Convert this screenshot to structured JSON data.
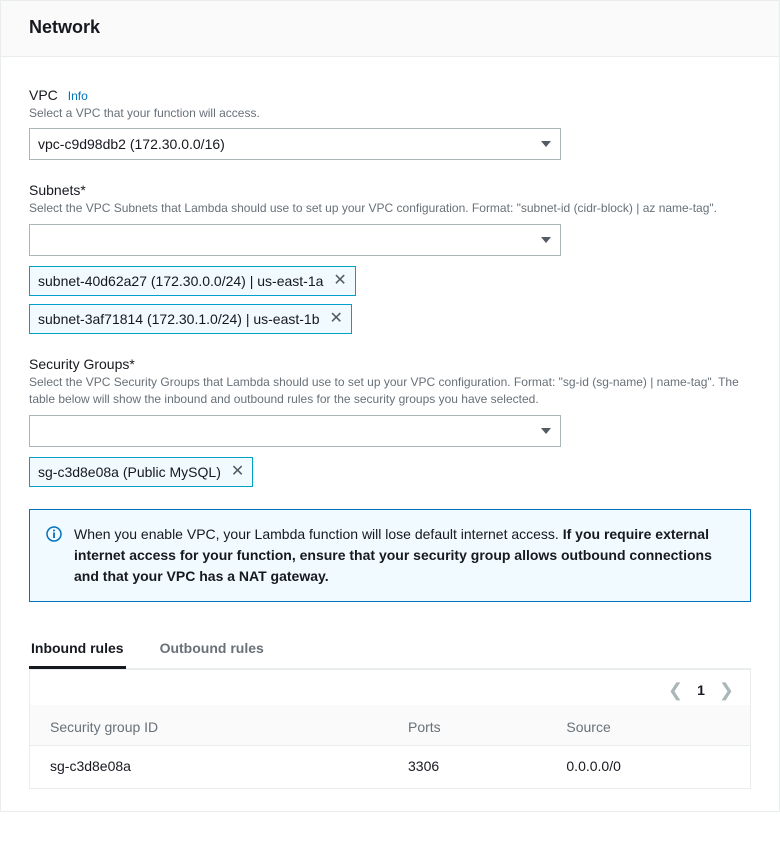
{
  "header": {
    "title": "Network"
  },
  "vpc": {
    "label": "VPC",
    "info_link": "Info",
    "description": "Select a VPC that your function will access.",
    "selected": "vpc-c9d98db2 (172.30.0.0/16)"
  },
  "subnets": {
    "label": "Subnets*",
    "description": "Select the VPC Subnets that Lambda should use to set up your VPC configuration. Format: \"subnet-id (cidr-block) | az name-tag\".",
    "selected": "",
    "tokens": [
      "subnet-40d62a27 (172.30.0.0/24) | us-east-1a",
      "subnet-3af71814 (172.30.1.0/24) | us-east-1b"
    ]
  },
  "security_groups": {
    "label": "Security Groups*",
    "description": "Select the VPC Security Groups that Lambda should use to set up your VPC configuration. Format: \"sg-id (sg-name) | name-tag\". The table below will show the inbound and outbound rules for the security groups you have selected.",
    "selected": "",
    "tokens": [
      "sg-c3d8e08a (Public MySQL)"
    ]
  },
  "alert": {
    "text_prefix": "When you enable VPC, your Lambda function will lose default internet access. ",
    "text_bold": "If you require external internet access for your function, ensure that your security group allows outbound connections and that your VPC has a NAT gateway."
  },
  "tabs": {
    "inbound": "Inbound rules",
    "outbound": "Outbound rules"
  },
  "pagination": {
    "page": "1"
  },
  "table": {
    "columns": {
      "sg": "Security group ID",
      "ports": "Ports",
      "source": "Source"
    },
    "rows": [
      {
        "sg": "sg-c3d8e08a",
        "ports": "3306",
        "source": "0.0.0.0/0"
      }
    ]
  }
}
